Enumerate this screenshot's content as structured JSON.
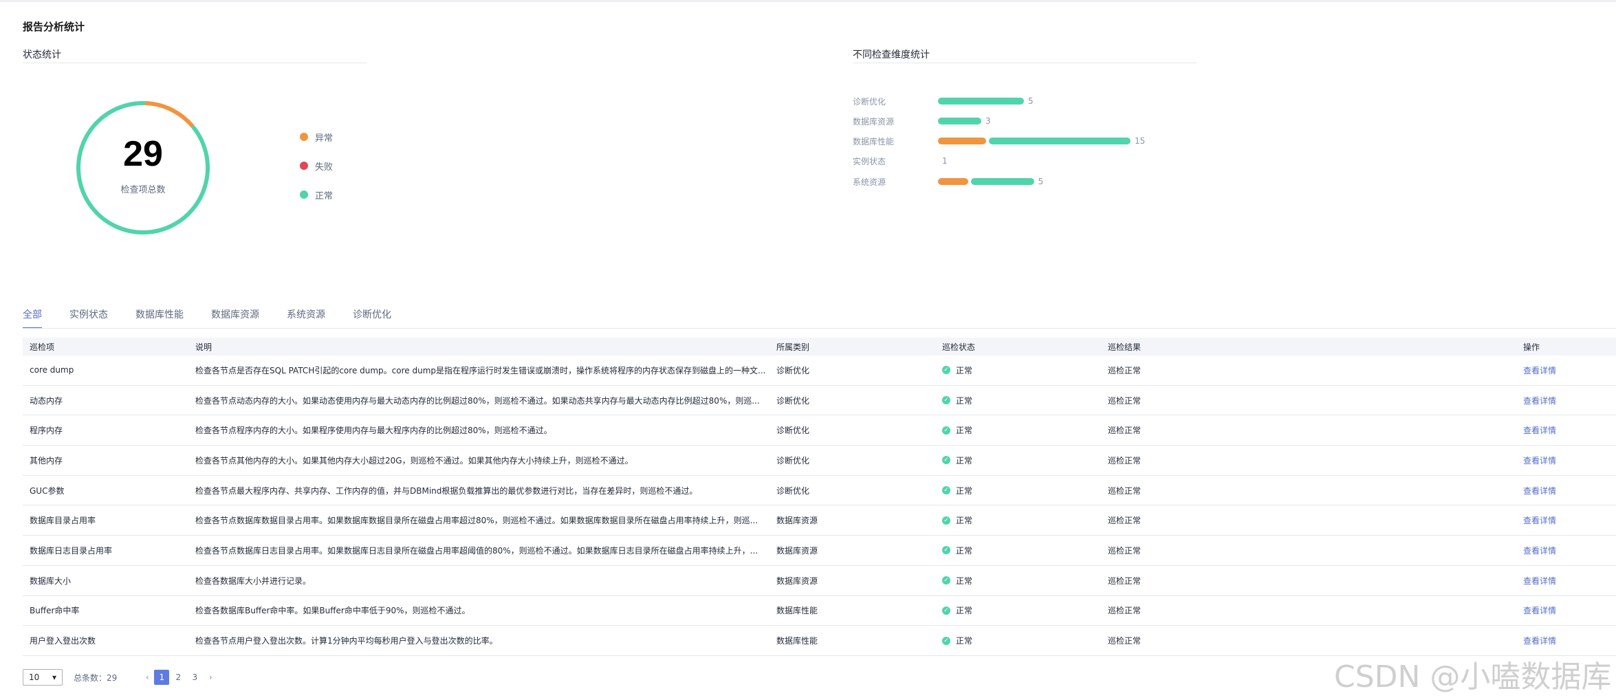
{
  "page_title": "报告分析统计",
  "status_section": {
    "title": "状态统计",
    "total": "29",
    "total_label": "检查项总数",
    "legend": [
      {
        "label": "异常",
        "color": "#f0953e",
        "value": 4
      },
      {
        "label": "失败",
        "color": "#e64556",
        "value": 0
      },
      {
        "label": "正常",
        "color": "#50d4ab",
        "value": 25
      }
    ]
  },
  "dimension_section": {
    "title": "不同检查维度统计",
    "rows": [
      {
        "label": "诊断优化",
        "abnormal": 0,
        "normal": 5,
        "count": "5"
      },
      {
        "label": "数据库资源",
        "abnormal": 0,
        "normal": 3,
        "count": "3"
      },
      {
        "label": "数据库性能",
        "abnormal": 2,
        "normal": 6,
        "count": "15"
      },
      {
        "label": "实例状态",
        "abnormal": 0,
        "normal": 0.6,
        "count": "1"
      },
      {
        "label": "系统资源",
        "abnormal": 1,
        "normal": 1.6,
        "count": "5"
      }
    ],
    "colors": {
      "abnormal": "#f0953e",
      "normal": "#50d4ab"
    }
  },
  "tabs": [
    "全部",
    "实例状态",
    "数据库性能",
    "数据库资源",
    "系统资源",
    "诊断优化"
  ],
  "table": {
    "headers": [
      "巡检项",
      "说明",
      "所属类别",
      "巡检状态",
      "巡检结果",
      "操作"
    ],
    "rows": [
      {
        "item": "core dump",
        "desc": "检查各节点是否存在SQL PATCH引起的core dump。core dump是指在程序运行时发生错误或崩溃时，操作系统将程序的内存状态保存到磁盘上的一种文...",
        "category": "诊断优化",
        "status": "正常",
        "result": "巡检正常",
        "action": "查看详情"
      },
      {
        "item": "动态内存",
        "desc": "检查各节点动态内存的大小。如果动态使用内存与最大动态内存的比例超过80%，则巡检不通过。如果动态共享内存与最大动态内存比例超过80%，则巡...",
        "category": "诊断优化",
        "status": "正常",
        "result": "巡检正常",
        "action": "查看详情"
      },
      {
        "item": "程序内存",
        "desc": "检查各节点程序内存的大小。如果程序使用内存与最大程序内存的比例超过80%，则巡检不通过。",
        "category": "诊断优化",
        "status": "正常",
        "result": "巡检正常",
        "action": "查看详情"
      },
      {
        "item": "其他内存",
        "desc": "检查各节点其他内存的大小。如果其他内存大小超过20G，则巡检不通过。如果其他内存大小持续上升，则巡检不通过。",
        "category": "诊断优化",
        "status": "正常",
        "result": "巡检正常",
        "action": "查看详情"
      },
      {
        "item": "GUC参数",
        "desc": "检查各节点最大程序内存、共享内存、工作内存的值，并与DBMind根据负载推算出的最优参数进行对比，当存在差异时，则巡检不通过。",
        "category": "诊断优化",
        "status": "正常",
        "result": "巡检正常",
        "action": "查看详情"
      },
      {
        "item": "数据库目录占用率",
        "desc": "检查各节点数据库数据目录占用率。如果数据库数据目录所在磁盘占用率超过80%，则巡检不通过。如果数据库数据目录所在磁盘占用率持续上升，则巡...",
        "category": "数据库资源",
        "status": "正常",
        "result": "巡检正常",
        "action": "查看详情"
      },
      {
        "item": "数据库日志目录占用率",
        "desc": "检查各节点数据库日志目录占用率。如果数据库日志目录所在磁盘占用率超阈值的80%，则巡检不通过。如果数据库日志目录所在磁盘占用率持续上升，...",
        "category": "数据库资源",
        "status": "正常",
        "result": "巡检正常",
        "action": "查看详情"
      },
      {
        "item": "数据库大小",
        "desc": "检查各数据库大小并进行记录。",
        "category": "数据库资源",
        "status": "正常",
        "result": "巡检正常",
        "action": "查看详情"
      },
      {
        "item": "Buffer命中率",
        "desc": "检查各数据库Buffer命中率。如果Buffer命中率低于90%，则巡检不通过。",
        "category": "数据库性能",
        "status": "正常",
        "result": "巡检正常",
        "action": "查看详情"
      },
      {
        "item": "用户登入登出次数",
        "desc": "检查各节点用户登入登出次数。计算1分钟内平均每秒用户登入与登出次数的比率。",
        "category": "数据库性能",
        "status": "正常",
        "result": "巡检正常",
        "action": "查看详情"
      }
    ]
  },
  "pagination": {
    "page_size": "10",
    "total_label": "总条数：29",
    "pages": [
      "1",
      "2",
      "3"
    ],
    "current": "1"
  },
  "watermark": "CSDN @小嗑数据库"
}
